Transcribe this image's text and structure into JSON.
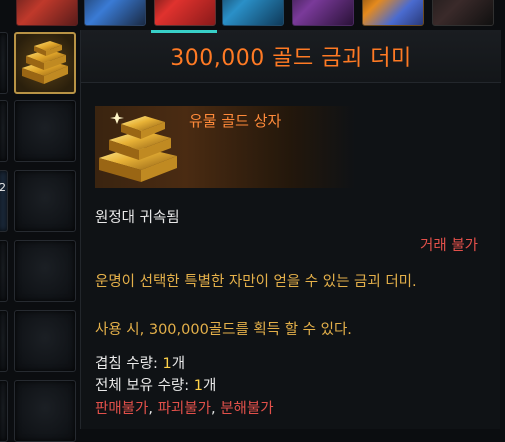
{
  "inventory": {
    "slot_badge": "2"
  },
  "tooltip": {
    "title": "300,000 골드 금괴 더미",
    "subtitle": "유물 골드 상자",
    "bound": "원정대 귀속됨",
    "trade": "거래 불가",
    "desc": "운명이 선택한 특별한 자만이 얻을 수 있는 금괴 더미.",
    "use": "사용 시, 300,000골드를 획득 할 수 있다.",
    "stack_label": "겹침 수량: ",
    "stack_value": "1",
    "stack_unit": "개",
    "owned_label": "전체 보유 수량: ",
    "owned_value": "1",
    "owned_unit": "개",
    "restrict_1": "판매불가",
    "restrict_2": "파괴불가",
    "restrict_3": "분해불가",
    "sep": ", "
  },
  "colors": {
    "title": "#ff7a24",
    "subtitle": "#ff8a3a",
    "description": "#e4b04a",
    "restriction": "#e2504a",
    "quantity": "#ffd24a",
    "frame_accent": "#38d0c8",
    "selected_border": "#b89345"
  },
  "icons": {
    "item": "gold-bars-icon"
  }
}
